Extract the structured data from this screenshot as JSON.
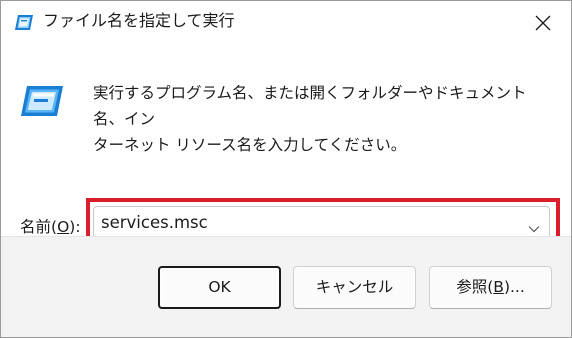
{
  "window": {
    "title": "ファイル名を指定して実行",
    "close_label": "Close"
  },
  "content": {
    "description_line1": "実行するプログラム名、または開くフォルダーやドキュメント名、イン",
    "description_line2": "ターネット リソース名を入力してください。",
    "name_label_prefix": "名前(",
    "name_label_accel": "O",
    "name_label_suffix": "):",
    "input_value": "services.msc"
  },
  "buttons": {
    "ok": "OK",
    "cancel": "キャンセル",
    "browse_prefix": "参照(",
    "browse_accel": "B",
    "browse_suffix": ")..."
  },
  "colors": {
    "highlight_border": "#dc1e2a",
    "icon_blue": "#1a7fd4"
  },
  "icons": {
    "title_icon": "run-dialog-icon",
    "main_icon": "run-dialog-icon",
    "close_icon": "close-icon",
    "dropdown_icon": "chevron-down-icon"
  }
}
